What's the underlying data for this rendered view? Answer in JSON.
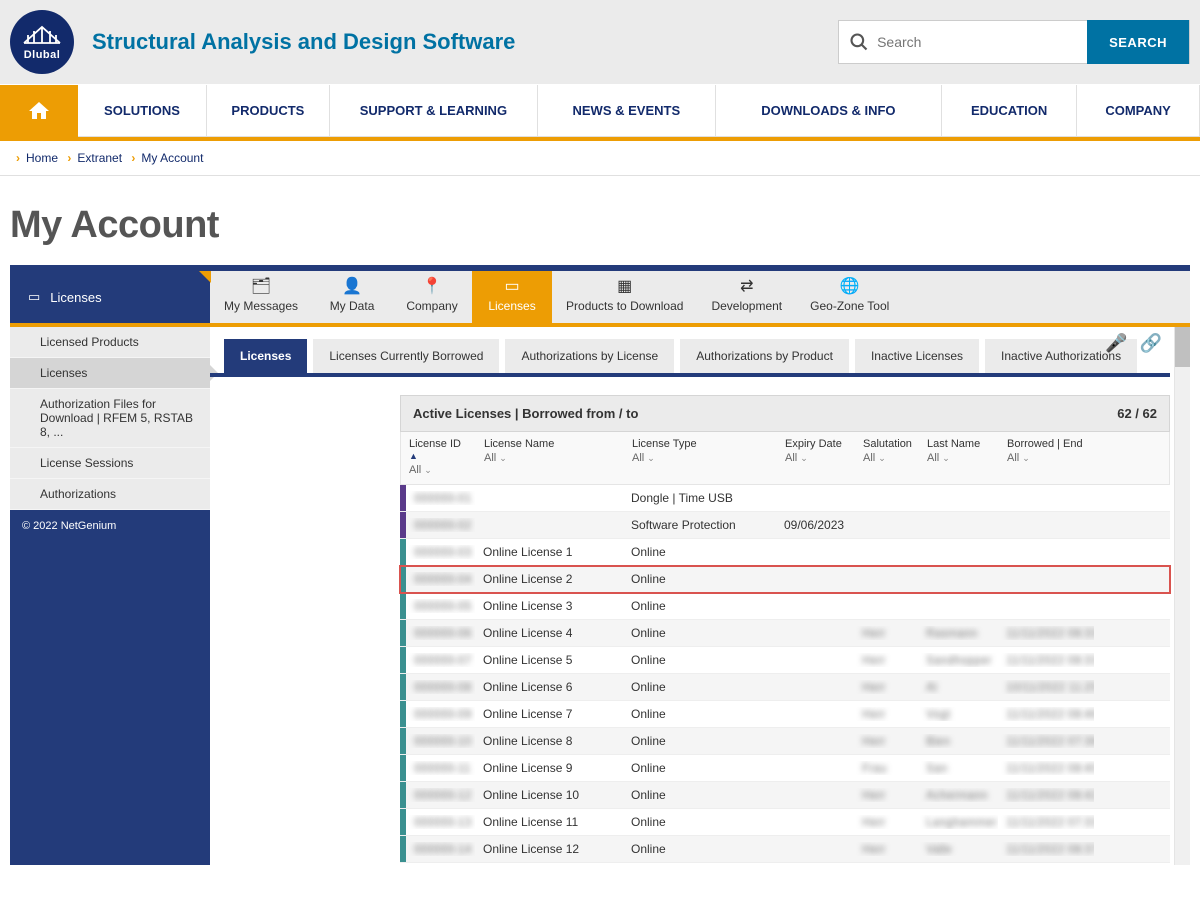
{
  "brand": {
    "name": "Dlubal",
    "tagline": "Structural Analysis and Design Software"
  },
  "search": {
    "placeholder": "Search",
    "button": "SEARCH"
  },
  "main_nav": [
    "SOLUTIONS",
    "PRODUCTS",
    "SUPPORT & LEARNING",
    "NEWS & EVENTS",
    "DOWNLOADS & INFO",
    "EDUCATION",
    "COMPANY"
  ],
  "breadcrumb": [
    "Home",
    "Extranet",
    "My Account"
  ],
  "page_title": "My Account",
  "account_tabs": {
    "current_label": "Licenses",
    "items": [
      {
        "label": "My Messages",
        "icon": "🗂"
      },
      {
        "label": "My Data",
        "icon": "👤"
      },
      {
        "label": "Company",
        "icon": "📍"
      },
      {
        "label": "Licenses",
        "icon": "▭",
        "active": true
      },
      {
        "label": "Products to Download",
        "icon": "▦"
      },
      {
        "label": "Development",
        "icon": "⇄"
      },
      {
        "label": "Geo-Zone Tool",
        "icon": "🌐"
      }
    ]
  },
  "sidebar_items": [
    {
      "label": "Licensed Products"
    },
    {
      "label": "Licenses",
      "current": true
    },
    {
      "label": "Authorization Files for Download | RFEM 5, RSTAB 8, ..."
    },
    {
      "label": "License Sessions"
    },
    {
      "label": "Authorizations"
    }
  ],
  "sidebar_footer": "© 2022 NetGenium",
  "subtabs": [
    "Licenses",
    "Licenses Currently Borrowed",
    "Authorizations by License",
    "Authorizations by Product",
    "Inactive Licenses",
    "Inactive Authorizations"
  ],
  "table": {
    "title": "Active Licenses  |  Borrowed from / to",
    "count": "62 / 62",
    "columns": [
      {
        "name": "License ID",
        "filter": "All",
        "sortable": true
      },
      {
        "name": "License Name",
        "filter": "All"
      },
      {
        "name": "License Type",
        "filter": "All"
      },
      {
        "name": "Expiry Date",
        "filter": "All"
      },
      {
        "name": "Salutation",
        "filter": "All"
      },
      {
        "name": "Last Name",
        "filter": "All"
      },
      {
        "name": "Borrowed | End",
        "filter": "All"
      }
    ],
    "rows": [
      {
        "stripe": "purple",
        "id": "000000-01",
        "name": "",
        "type": "Dongle | Time USB",
        "exp": "",
        "sal": "",
        "last": "",
        "borr": "",
        "blur": true
      },
      {
        "stripe": "purple",
        "id": "000000-02",
        "name": "",
        "type": "Software Protection",
        "exp": "09/06/2023",
        "sal": "",
        "last": "",
        "borr": "",
        "blur": true
      },
      {
        "stripe": "teal",
        "id": "000000-03",
        "name": "Online License 1",
        "type": "Online",
        "exp": "",
        "sal": "",
        "last": "",
        "borr": "",
        "blur": true
      },
      {
        "stripe": "teal",
        "id": "000000-04",
        "name": "Online License 2",
        "type": "Online",
        "exp": "",
        "sal": "",
        "last": "",
        "borr": "",
        "blur": true,
        "highlight": true
      },
      {
        "stripe": "teal",
        "id": "000000-05",
        "name": "Online License 3",
        "type": "Online",
        "exp": "",
        "sal": "",
        "last": "",
        "borr": "",
        "blur": true
      },
      {
        "stripe": "teal",
        "id": "000000-06",
        "name": "Online License 4",
        "type": "Online",
        "exp": "",
        "sal": "Herr",
        "last": "Rasmann",
        "borr": "11/11/2022 08:33",
        "blur": true
      },
      {
        "stripe": "teal",
        "id": "000000-07",
        "name": "Online License 5",
        "type": "Online",
        "exp": "",
        "sal": "Herr",
        "last": "Sandhopper",
        "borr": "11/11/2022 08:33",
        "blur": true
      },
      {
        "stripe": "teal",
        "id": "000000-08",
        "name": "Online License 6",
        "type": "Online",
        "exp": "",
        "sal": "Herr",
        "last": "Al",
        "borr": "10/11/2022 11:25",
        "blur": true
      },
      {
        "stripe": "teal",
        "id": "000000-09",
        "name": "Online License 7",
        "type": "Online",
        "exp": "",
        "sal": "Herr",
        "last": "Vogt",
        "borr": "11/11/2022 08:46",
        "blur": true
      },
      {
        "stripe": "teal",
        "id": "000000-10",
        "name": "Online License 8",
        "type": "Online",
        "exp": "",
        "sal": "Herr",
        "last": "Bien",
        "borr": "11/11/2022 07:38",
        "blur": true
      },
      {
        "stripe": "teal",
        "id": "000000-11",
        "name": "Online License 9",
        "type": "Online",
        "exp": "",
        "sal": "Frau",
        "last": "San",
        "borr": "11/11/2022 08:40",
        "blur": true
      },
      {
        "stripe": "teal",
        "id": "000000-12",
        "name": "Online License 10",
        "type": "Online",
        "exp": "",
        "sal": "Herr",
        "last": "Achermann",
        "borr": "11/11/2022 08:42",
        "blur": true
      },
      {
        "stripe": "teal",
        "id": "000000-13",
        "name": "Online License 11",
        "type": "Online",
        "exp": "",
        "sal": "Herr",
        "last": "Langhammer",
        "borr": "11/11/2022 07:33",
        "blur": true
      },
      {
        "stripe": "teal",
        "id": "000000-14",
        "name": "Online License 12",
        "type": "Online",
        "exp": "",
        "sal": "Herr",
        "last": "Valle",
        "borr": "11/11/2022 08:37",
        "blur": true
      }
    ]
  }
}
